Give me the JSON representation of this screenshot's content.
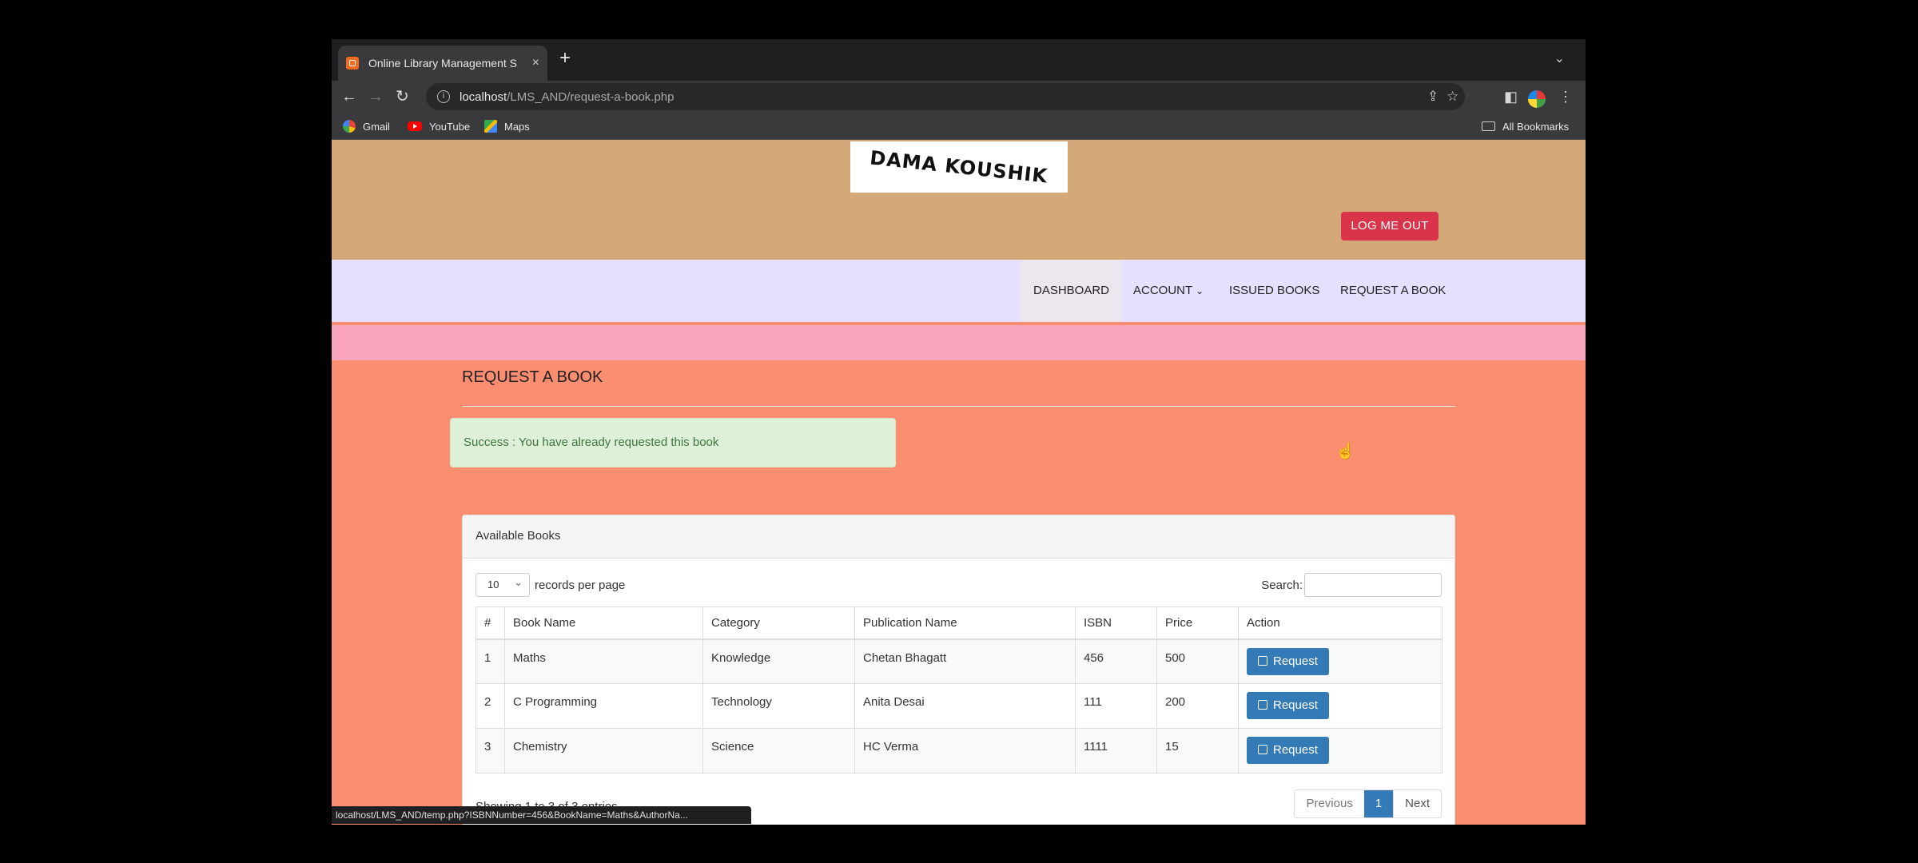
{
  "browser": {
    "tab_title": "Online Library Management S",
    "tab_close": "×",
    "new_tab": "+",
    "url_host": "localhost",
    "url_path": "/LMS_AND/request-a-book.php",
    "bookmarks": [
      "Gmail",
      "YouTube",
      "Maps"
    ],
    "all_bookmarks": "All Bookmarks",
    "status_url": "localhost/LMS_AND/temp.php?ISBNNumber=456&BookName=Maths&AuthorNa..."
  },
  "header": {
    "logo_text": "DAMA KOUSHIK",
    "logout_label": "LOG ME OUT"
  },
  "nav": {
    "dashboard": "DASHBOARD",
    "account": "ACCOUNT",
    "issued_books": "ISSUED BOOKS",
    "request_book": "REQUEST A BOOK"
  },
  "main": {
    "title": "REQUEST A BOOK",
    "alert": "Success : You have already requested this book"
  },
  "panel": {
    "heading": "Available Books",
    "page_length": "10",
    "records_per_page": "records per page",
    "search_label": "Search:",
    "columns": [
      "#",
      "Book Name",
      "Category",
      "Publication Name",
      "ISBN",
      "Price",
      "Action"
    ],
    "rows": [
      {
        "num": "1",
        "book": "Maths",
        "category": "Knowledge",
        "publication": "Chetan Bhagatt",
        "isbn": "456",
        "price": "500",
        "action": "Request"
      },
      {
        "num": "2",
        "book": "C Programming",
        "category": "Technology",
        "publication": "Anita Desai",
        "isbn": "111",
        "price": "200",
        "action": "Request"
      },
      {
        "num": "3",
        "book": "Chemistry",
        "category": "Science",
        "publication": "HC Verma",
        "isbn": "1111",
        "price": "15",
        "action": "Request"
      }
    ],
    "info": "Showing 1 to 3 of 3 entries",
    "pager": {
      "previous": "Previous",
      "current": "1",
      "next": "Next"
    }
  },
  "colors": {
    "header_bg": "#d4a878",
    "menubar_bg": "#e4e0fd",
    "pinkbar_bg": "#fca5bf",
    "page_bg": "#fb8d70",
    "logout_btn": "#d9354a",
    "primary_btn": "#337ab7"
  }
}
